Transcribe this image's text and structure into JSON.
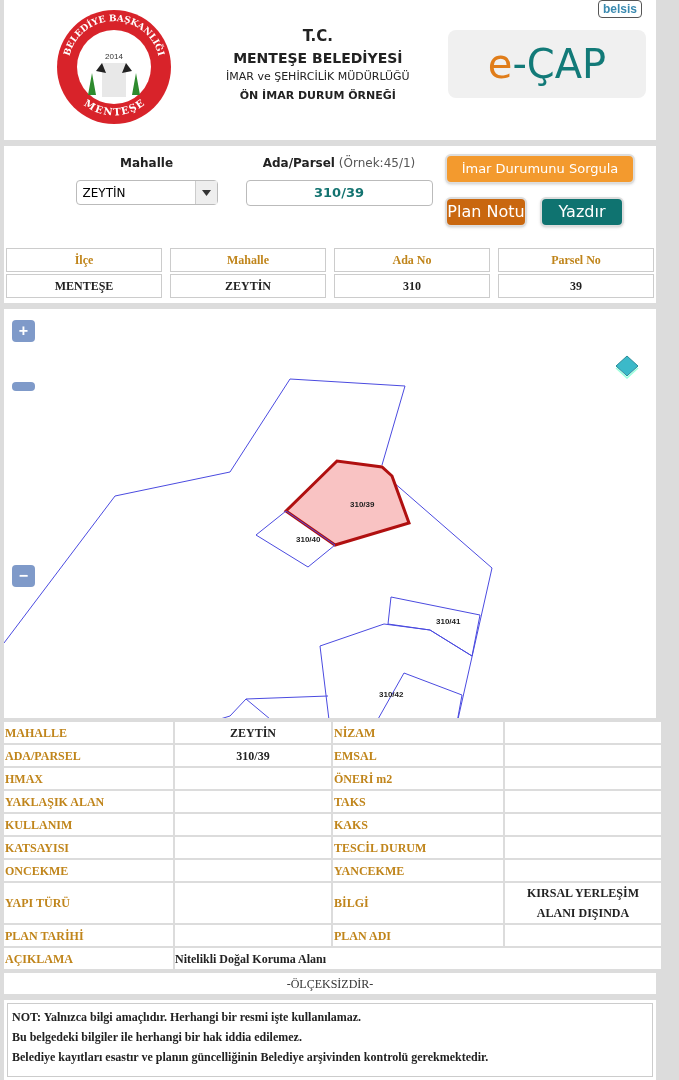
{
  "header": {
    "emblem": {
      "top_text": "BELEDİYE BAŞKANLIĞI",
      "year": "2014",
      "bottom_text": "MENTEŞE"
    },
    "tc": "T.C.",
    "municipality": "MENTEŞE BELEDİYESİ",
    "department": "İMAR ve ŞEHİRCİLİK MÜDÜRLÜĞÜ",
    "document_title": "ÖN İMAR DURUM ÖRNEĞİ",
    "badge": "belsis",
    "app_logo": [
      "e",
      "-ÇAP"
    ]
  },
  "form": {
    "mahalle_label": "Mahalle",
    "mahalle_value": "ZEYTİN",
    "parcel_label": "Ada/Parsel",
    "parcel_hint": "(Örnek:45/1)",
    "parcel_value": "310/39",
    "buttons": [
      {
        "kind": "query",
        "label": "İmar Durumunu Sorgula"
      },
      {
        "kind": "note",
        "label": "Plan Notu"
      },
      {
        "kind": "print",
        "label": "Yazdır"
      }
    ]
  },
  "summary": {
    "columns": [
      "İlçe",
      "Mahalle",
      "Ada No",
      "Parsel No"
    ],
    "values": [
      "MENTEŞE",
      "ZEYTİN",
      "310",
      "39"
    ]
  },
  "map": {
    "controls": [
      {
        "kind": "zoom_in",
        "label": "+"
      },
      {
        "kind": "bar"
      },
      {
        "kind": "zoom_out",
        "label": "−"
      }
    ],
    "parcels": [
      {
        "label": "310/39",
        "selected": true
      },
      {
        "label": "310/40",
        "selected": false
      },
      {
        "label": "310/41",
        "selected": false
      },
      {
        "label": "310/42",
        "selected": false
      }
    ]
  },
  "details": [
    {
      "label": "MAHALLE",
      "value": "ZEYTİN",
      "label2": "NİZAM"
    },
    {
      "label": "ADA/PARSEL",
      "value": "310/39",
      "label2": "EMSAL"
    },
    {
      "label": "HMAX",
      "label2": "ÖNERİ m2"
    },
    {
      "label": "YAKLAŞIK ALAN",
      "label2": "TAKS"
    },
    {
      "label": "KULLANIM",
      "label2": "KAKS"
    },
    {
      "label": "KATSAYISI",
      "label2": "TESCİL DURUM"
    },
    {
      "label": "ONCEKME",
      "label2": "YANCEKME"
    },
    {
      "label": "YAPI TÜRÜ",
      "label2": "BİLGİ",
      "value2": "KIRSAL YERLEŞİM ALANI DIŞINDA"
    },
    {
      "label": "PLAN TARİHİ",
      "label2": "PLAN ADI"
    },
    {
      "label": "AÇIKLAMA",
      "value": "Nitelikli Doğal Koruma Alanı"
    }
  ],
  "scale_note": "-ÖLÇEKSİZDİR-",
  "notes": [
    "NOT: Yalnızca bilgi amaçlıdır. Herhangi bir resmi işte kullanılamaz.",
    "Bu belgedeki bilgiler ile herhangi bir hak iddia edilemez.",
    "Belediye kayıtları esastır ve planın güncelliğinin Belediye arşivinden kontrolü gerekmektedir."
  ]
}
